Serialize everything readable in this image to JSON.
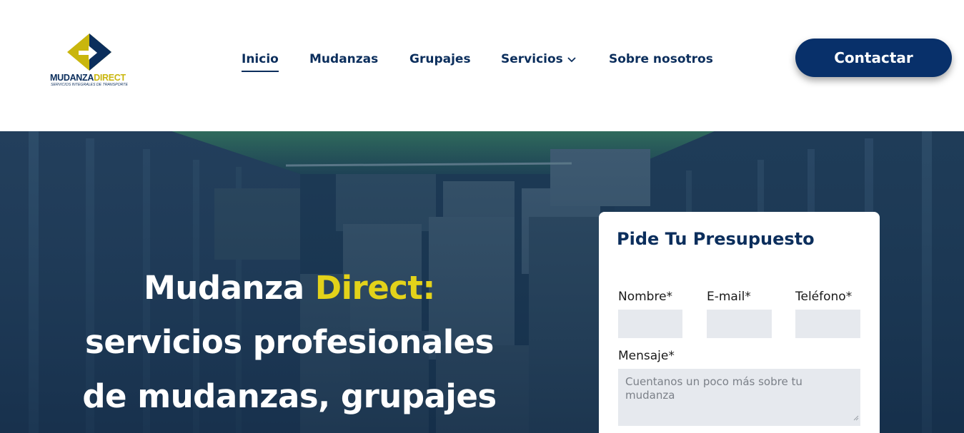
{
  "brand": {
    "word_part1": "MUDANZA",
    "word_part2": "DIRECT",
    "tagline": "SERVICIOS INTEGRALES DE TRANSPORTE",
    "colors": {
      "navy": "#0b2e5c",
      "yellow": "#c9b60d"
    }
  },
  "nav": {
    "items": [
      {
        "label": "Inicio",
        "active": true
      },
      {
        "label": "Mudanzas"
      },
      {
        "label": "Grupajes"
      },
      {
        "label": "Servicios",
        "has_dropdown": true,
        "icon": "chevron-down-icon"
      },
      {
        "label": "Sobre nosotros"
      }
    ],
    "cta_label": "Contactar"
  },
  "hero": {
    "title_part1": "Mudanza ",
    "title_highlight": "Direct:",
    "title_line2": "servicios profesionales",
    "title_line3": "de mudanzas, grupajes",
    "accent_color": "#e3d21a"
  },
  "form": {
    "title": "Pide Tu Presupuesto",
    "fields": {
      "name_label": "Nombre*",
      "email_label": "E-mail*",
      "phone_label": "Teléfono*",
      "message_label": "Mensaje*",
      "message_placeholder": "Cuentanos un poco más sobre tu mudanza"
    }
  }
}
